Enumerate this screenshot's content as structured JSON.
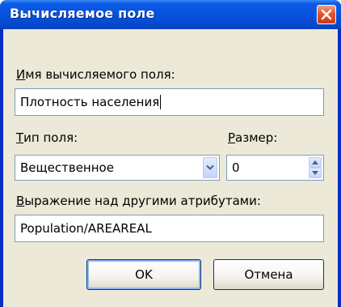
{
  "dialog": {
    "title": "Вычисляемое поле",
    "name_label": {
      "underlined": "И",
      "rest": "мя вычисляемого поля:"
    },
    "name_value": "Плотность населения",
    "type_label": {
      "underlined": "Т",
      "rest": "ип поля:"
    },
    "type_value": "Вещественное",
    "size_label": {
      "underlined": "Р",
      "rest": "азмер:"
    },
    "size_value": "0",
    "expr_label": {
      "underlined": "В",
      "rest": "ыражение над другими атрибутами:"
    },
    "expr_value": "Population/AREAREAL",
    "ok_label": "OK",
    "cancel_label": "Отмена"
  }
}
